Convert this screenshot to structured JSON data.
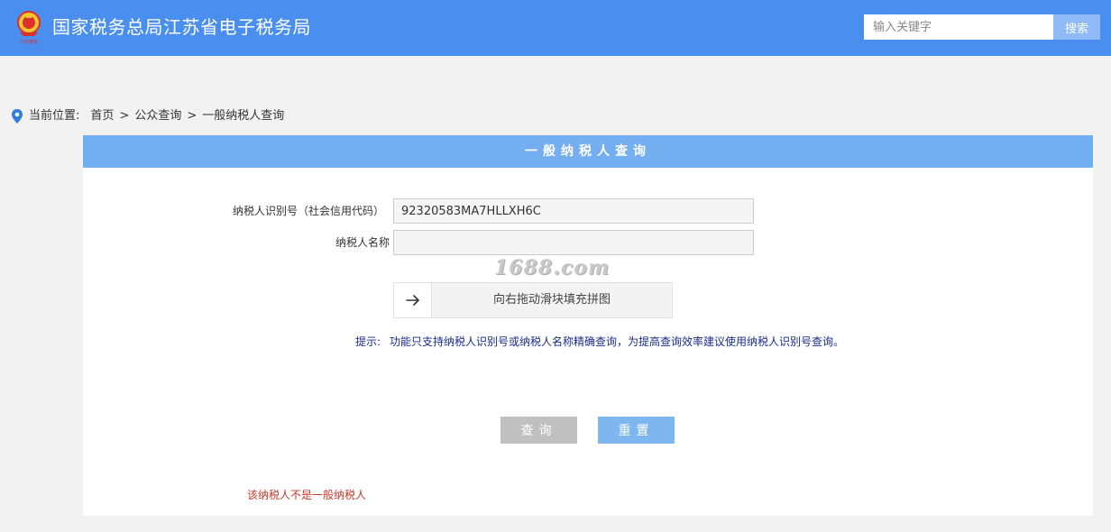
{
  "header": {
    "site_title": "国家税务总局江苏省电子税务局",
    "logo_caption": "江苏税务",
    "search_placeholder": "输入关键字",
    "search_button": "搜索"
  },
  "breadcrumb": {
    "prefix": "当前位置:",
    "items": [
      "首页",
      "公众查询",
      "一般纳税人查询"
    ],
    "separator": ">"
  },
  "panel": {
    "title": "一般纳税人查询",
    "fields": {
      "taxpayer_id_label": "纳税人识别号（社会信用代码）",
      "taxpayer_id_value": "92320583MA7HLLXH6C",
      "taxpayer_name_label": "纳税人名称",
      "taxpayer_name_value": ""
    },
    "watermark": "1688.com",
    "slider": {
      "handle_icon": "arrow-right-icon",
      "text": "向右拖动滑块填充拼图"
    },
    "tip": {
      "label": "提示:",
      "text": "功能只支持纳税人识别号或纳税人名称精确查询，为提高查询效率建议使用纳税人识别号查询。"
    },
    "buttons": {
      "query": "查询",
      "reset": "重置"
    },
    "result_message": "该纳税人不是一般纳税人"
  },
  "colors": {
    "header_bg": "#4a8ff0",
    "panel_head_bg": "#72aef0",
    "tip_text": "#1a2c8c",
    "result_text": "#c0392b"
  }
}
